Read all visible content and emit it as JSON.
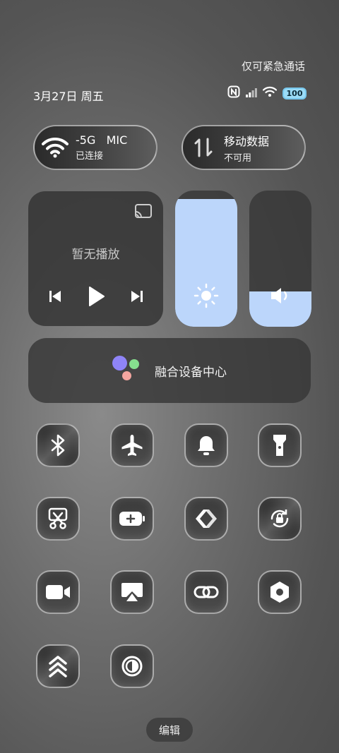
{
  "header": {
    "emergency_text": "仅可紧急通话",
    "date": "3月27日 周五",
    "battery": "100"
  },
  "wifi_tile": {
    "title": "-5G   MIC",
    "subtitle": "已连接",
    "icon": "wifi-icon"
  },
  "data_tile": {
    "title": "移动数据",
    "subtitle": "不可用",
    "icon": "data-arrows-icon"
  },
  "media": {
    "title": "暂无播放"
  },
  "sliders": {
    "brightness_level": 0.94,
    "volume_level": 0.26
  },
  "hub": {
    "label": "融合设备中心",
    "colors": {
      "purple": "#8f84f7",
      "green": "#86e08e",
      "pink": "#f4a6a0"
    }
  },
  "toggles": [
    {
      "id": "bluetooth",
      "icon": "bluetooth-icon",
      "active": true
    },
    {
      "id": "airplane",
      "icon": "airplane-icon",
      "active": false
    },
    {
      "id": "bell",
      "icon": "bell-icon",
      "active": false
    },
    {
      "id": "flashlight",
      "icon": "flashlight-icon",
      "active": false
    },
    {
      "id": "screenshot",
      "icon": "scissors-icon",
      "active": false
    },
    {
      "id": "battery-saver",
      "icon": "battery-plus-icon",
      "active": false
    },
    {
      "id": "nearby-share",
      "icon": "share-arrows-icon",
      "active": false
    },
    {
      "id": "rotation-lock",
      "icon": "rotation-lock-icon",
      "active": true
    },
    {
      "id": "video",
      "icon": "video-camera-icon",
      "active": false
    },
    {
      "id": "screen-cast",
      "icon": "screen-cast-icon",
      "active": false
    },
    {
      "id": "link",
      "icon": "link-icon",
      "active": false
    },
    {
      "id": "settings",
      "icon": "hexagon-settings-icon",
      "active": false
    },
    {
      "id": "performance",
      "icon": "chevrons-up-icon",
      "active": true
    },
    {
      "id": "dark-mode",
      "icon": "contrast-icon",
      "active": false
    }
  ],
  "edit_button": {
    "label": "编辑"
  },
  "colors": {
    "accent": "#bcd6fb",
    "battery": "#9bdcf7"
  }
}
